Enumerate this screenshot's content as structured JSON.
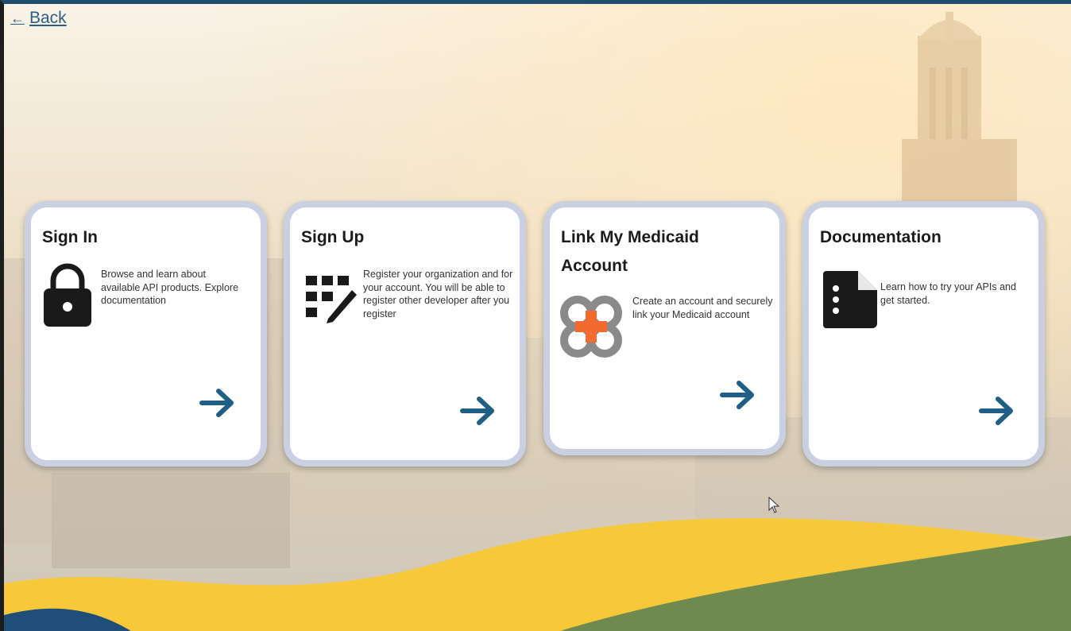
{
  "nav": {
    "back_label": "Back"
  },
  "cards": [
    {
      "title": "Sign In",
      "description": "Browse and learn about available API products. Explore documentation"
    },
    {
      "title": "Sign Up",
      "description": "Register your organization and for your account. You will be able to register other developer after you register"
    },
    {
      "title": "Link My Medicaid Account",
      "description": "Create an account and securely link your Medicaid account"
    },
    {
      "title": "Documentation",
      "description": "Learn how to try your APIs and get started."
    }
  ],
  "colors": {
    "accent": "#1f5f86",
    "wave_yellow": "#f7c93a",
    "wave_green": "#6e8a4e",
    "wave_blue": "#1f4e79",
    "medicaid_orange": "#f26a2e"
  }
}
